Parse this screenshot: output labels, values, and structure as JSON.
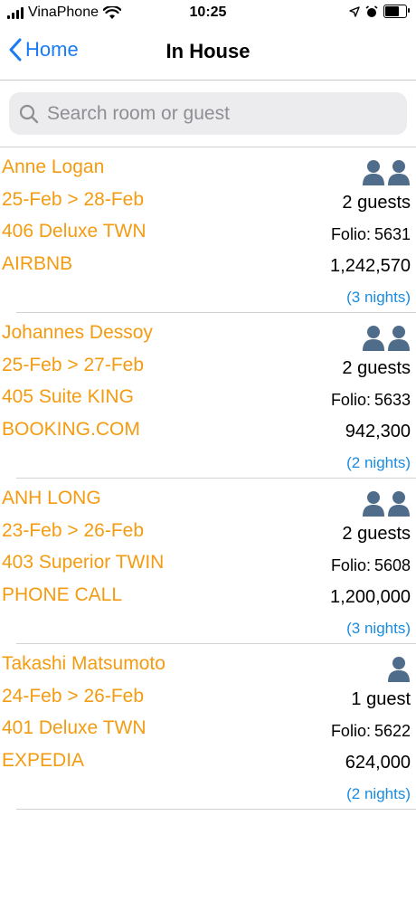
{
  "status_bar": {
    "carrier": "VinaPhone",
    "time": "10:25"
  },
  "nav": {
    "back_label": "Home",
    "title": "In House"
  },
  "search": {
    "placeholder": "Search room or guest"
  },
  "reservations": [
    {
      "name": "Anne Logan",
      "dates": "25-Feb > 28-Feb",
      "room": "406 Deluxe TWN",
      "source": "AIRBNB",
      "guest_count": 2,
      "guests": "2 guests",
      "folio_label": "Folio:",
      "folio": "5631",
      "amount": "1,242,570",
      "nights": "(3 nights)"
    },
    {
      "name": "Johannes Dessoy",
      "dates": "25-Feb > 27-Feb",
      "room": "405 Suite KING",
      "source": "BOOKING.COM",
      "guest_count": 2,
      "guests": "2 guests",
      "folio_label": "Folio:",
      "folio": "5633",
      "amount": "942,300",
      "nights": "(2 nights)"
    },
    {
      "name": "ANH LONG",
      "dates": "23-Feb > 26-Feb",
      "room": "403 Superior TWIN",
      "source": "PHONE CALL",
      "guest_count": 2,
      "guests": "2 guests",
      "folio_label": "Folio:",
      "folio": "5608",
      "amount": "1,200,000",
      "nights": "(3 nights)"
    },
    {
      "name": "Takashi Matsumoto",
      "dates": "24-Feb > 26-Feb",
      "room": "401 Deluxe TWN",
      "source": "EXPEDIA",
      "guest_count": 1,
      "guests": "1 guest",
      "folio_label": "Folio:",
      "folio": "5622",
      "amount": "624,000",
      "nights": "(2 nights)"
    }
  ],
  "colors": {
    "accent": "#1a7cf5",
    "guest_text": "#f39c12",
    "nights_text": "#1a8be0",
    "person_icon": "#4f6d8a"
  }
}
